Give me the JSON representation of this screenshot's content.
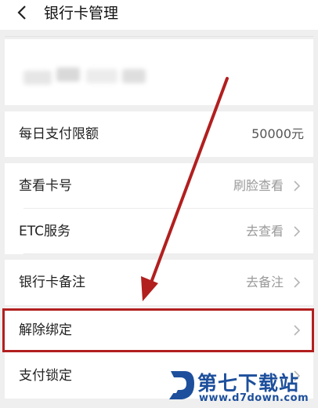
{
  "header": {
    "title": "银行卡管理"
  },
  "limit_row": {
    "label": "每日支付限额",
    "value": "50000元"
  },
  "rows": [
    {
      "label": "查看卡号",
      "value": "刷脸查看"
    },
    {
      "label": "ETC服务",
      "value": "去查看"
    },
    {
      "label": "银行卡备注",
      "value": "去备注"
    },
    {
      "label": "解除绑定",
      "value": ""
    },
    {
      "label": "支付锁定",
      "value": ""
    }
  ],
  "colors": {
    "highlight": "#b21f1f",
    "watermark": "#1d4f9c"
  },
  "watermark": {
    "title": "第七下载站",
    "url": "www.d7down.com"
  }
}
